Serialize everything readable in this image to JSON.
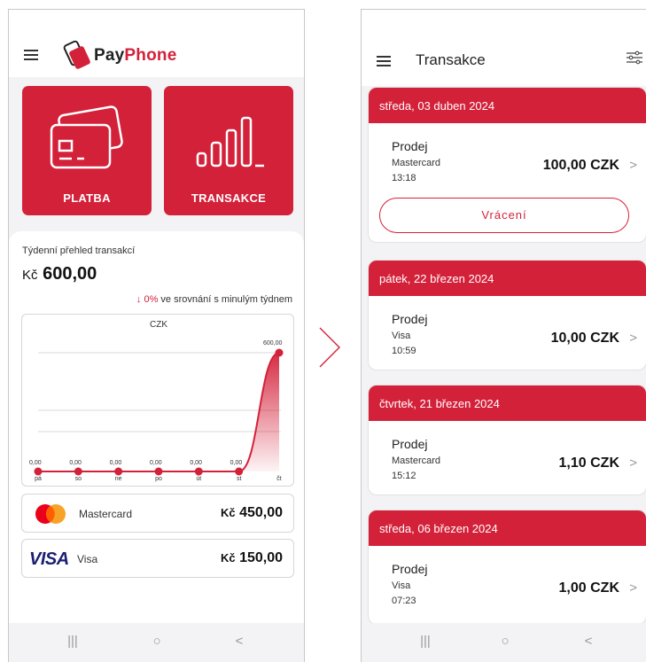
{
  "dashboard": {
    "app_name_part1": "Pay",
    "app_name_part2": "Phone",
    "tiles": [
      {
        "label": "PLATBA",
        "icon": "cards-icon"
      },
      {
        "label": "TRANSAKCE",
        "icon": "bars-icon"
      }
    ],
    "weekly": {
      "title": "Týdenní přehled transakcí",
      "currency": "Kč",
      "amount": "600,00",
      "compare_pct": "0%",
      "compare_text": " ve srovnání s minulým týdnem"
    },
    "payments": [
      {
        "name": "Mastercard",
        "currency": "Kč",
        "amount": "450,00",
        "logo": "mastercard-logo"
      },
      {
        "name": "Visa",
        "currency": "Kč",
        "amount": "150,00",
        "logo": "visa-logo",
        "logo_text": "VISA"
      }
    ]
  },
  "chart_data": {
    "type": "area",
    "title": "CZK",
    "categories": [
      "pá",
      "so",
      "ne",
      "po",
      "út",
      "st",
      "čt"
    ],
    "values": [
      0,
      0,
      0,
      0,
      0,
      0,
      600
    ],
    "value_labels": [
      "0,00",
      "0,00",
      "0,00",
      "0,00",
      "0,00",
      "0,00",
      "600,00"
    ],
    "color": "#d4213a",
    "grid": true
  },
  "transactions_screen": {
    "title": "Transakce",
    "refund_label": "Vrácení",
    "days": [
      {
        "date": "středa, 03 duben 2024",
        "items": [
          {
            "type": "Prodej",
            "card": "Mastercard",
            "time": "13:18",
            "amount": "100,00 CZK"
          }
        ]
      },
      {
        "date": "pátek, 22 březen 2024",
        "items": [
          {
            "type": "Prodej",
            "card": "Visa",
            "time": "10:59",
            "amount": "10,00 CZK"
          }
        ]
      },
      {
        "date": "čtvrtek, 21 březen 2024",
        "items": [
          {
            "type": "Prodej",
            "card": "Mastercard",
            "time": "15:12",
            "amount": "1,10 CZK"
          }
        ]
      },
      {
        "date": "středa, 06 březen 2024",
        "items": [
          {
            "type": "Prodej",
            "card": "Visa",
            "time": "07:23",
            "amount": "1,00 CZK"
          }
        ]
      }
    ]
  },
  "colors": {
    "brand": "#d4213a",
    "mastercard_red": "#eb001b",
    "mastercard_orange": "#f79e1b",
    "visa_blue": "#1a1f71"
  },
  "navbar": {
    "recent": "|||",
    "home": "○",
    "back": "<"
  }
}
